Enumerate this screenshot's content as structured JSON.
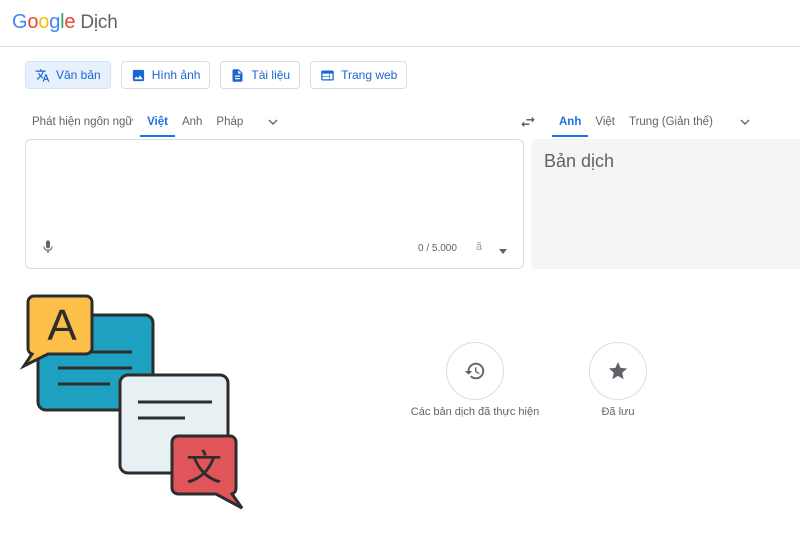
{
  "header": {
    "logo_letters": [
      {
        "char": "G",
        "color": "#4285F4"
      },
      {
        "char": "o",
        "color": "#EA4335"
      },
      {
        "char": "o",
        "color": "#FBBC05"
      },
      {
        "char": "g",
        "color": "#4285F4"
      },
      {
        "char": "l",
        "color": "#34A853"
      },
      {
        "char": "e",
        "color": "#EA4335"
      }
    ],
    "product": "Dịch"
  },
  "modes": [
    {
      "label": "Văn bản",
      "icon": "translate-icon",
      "active": true
    },
    {
      "label": "Hình ảnh",
      "icon": "image-icon",
      "active": false
    },
    {
      "label": "Tài liệu",
      "icon": "document-icon",
      "active": false
    },
    {
      "label": "Trang web",
      "icon": "web-icon",
      "active": false
    }
  ],
  "source_langs": {
    "items": [
      "Phát hiện ngôn ngữ",
      "Việt",
      "Anh",
      "Pháp"
    ],
    "selected": "Việt"
  },
  "target_langs": {
    "items": [
      "Anh",
      "Việt",
      "Trung (Giản thể)"
    ],
    "selected": "Anh"
  },
  "source": {
    "value": "",
    "counter": "0 / 5.000",
    "tool_glyph": "ã"
  },
  "target": {
    "placeholder": "Bản dịch"
  },
  "illustration": {
    "bubble_a_letter": "A",
    "bubble_b_glyph": "文",
    "colors": {
      "yellow": "#fbbf4a",
      "teal": "#1ea0c0",
      "light": "#e7f1f3",
      "red": "#e0555a",
      "outline": "#2d2d2d"
    }
  },
  "actions": [
    {
      "label": "Các bản dịch đã thực hiện",
      "icon": "history-icon"
    },
    {
      "label": "Đã lưu",
      "icon": "star-icon"
    }
  ],
  "colors": {
    "accent": "#1a73e8",
    "text": "#5f6368"
  }
}
